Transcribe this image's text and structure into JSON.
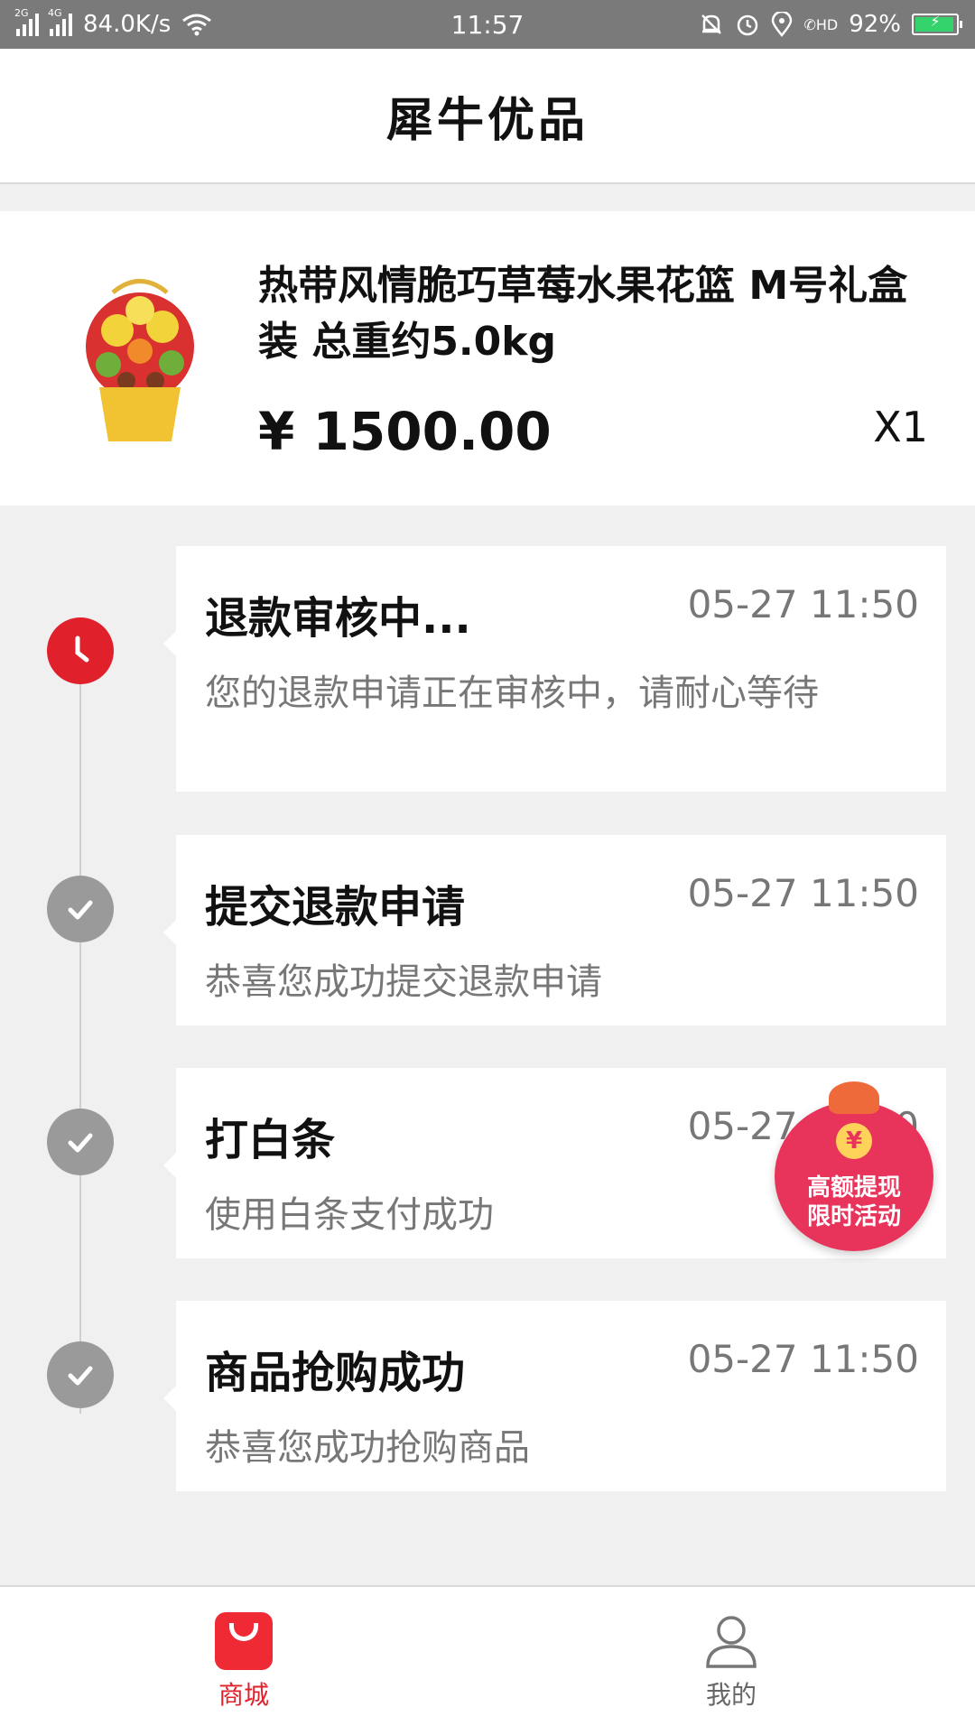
{
  "status_bar": {
    "net1": "2G",
    "net2": "4G",
    "speed": "84.0K/s",
    "time": "11:57",
    "hd": "HD",
    "battery": "92%"
  },
  "header": {
    "title": "犀牛优品"
  },
  "product": {
    "name": "热带风情脆巧草莓水果花篮 M号礼盒装 总重约5.0kg",
    "price": "¥ 1500.00",
    "quantity": "X1",
    "image_icon": "fruit-basket-image"
  },
  "timeline": [
    {
      "status_icon": "clock-icon",
      "color": "#e0202a",
      "title": "退款审核中...",
      "time": "05-27 11:50",
      "desc": "您的退款申请正在审核中，请耐心等待"
    },
    {
      "status_icon": "check-icon",
      "color": "#9a9a9a",
      "title": "提交退款申请",
      "time": "05-27 11:50",
      "desc": "恭喜您成功提交退款申请"
    },
    {
      "status_icon": "check-icon",
      "color": "#9a9a9a",
      "title": "打白条",
      "time": "05-27 11:50",
      "desc": "使用白条支付成功"
    },
    {
      "status_icon": "check-icon",
      "color": "#9a9a9a",
      "title": "商品抢购成功",
      "time": "05-27 11:50",
      "desc": "恭喜您成功抢购商品"
    }
  ],
  "promo": {
    "symbol": "¥",
    "line1": "高额提现",
    "line2": "限时活动"
  },
  "tabbar": {
    "tabs": [
      {
        "label": "商城",
        "icon": "shopping-bag-icon",
        "active": true
      },
      {
        "label": "我的",
        "icon": "user-icon",
        "active": false
      }
    ],
    "accent": "#e0202a"
  }
}
